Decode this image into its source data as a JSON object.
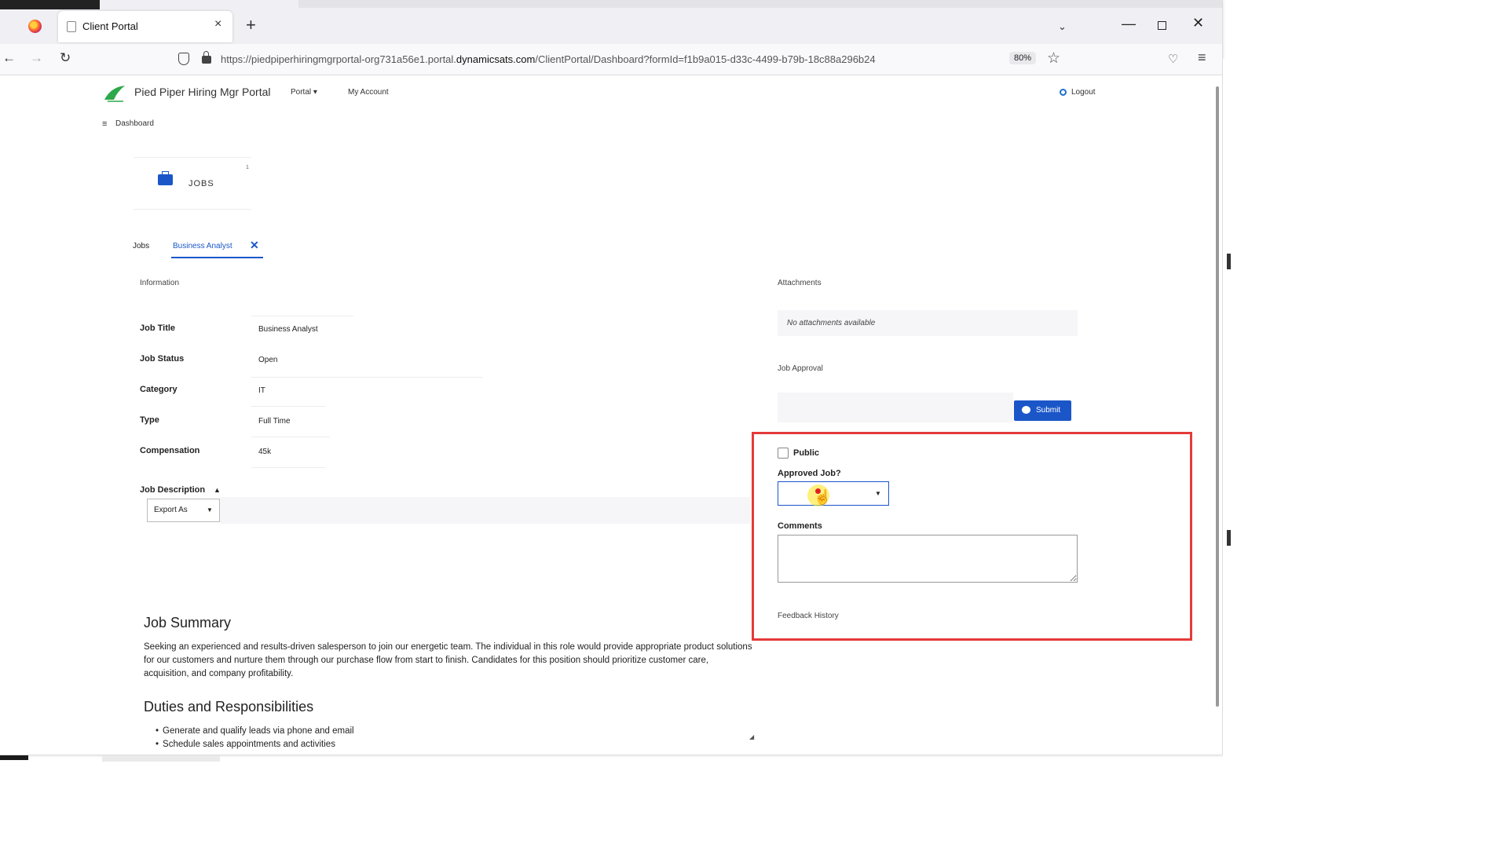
{
  "browser": {
    "tab_title": "Client Portal",
    "url_prefix": "https://piedpiperhiringmgrportal-org731a56e1.portal.",
    "url_host": "dynamicsats.com",
    "url_path": "/ClientPortal/Dashboard?formId=f1b9a015-d33c-4499-b79b-18c88a296b24",
    "zoom": "80%"
  },
  "header": {
    "brand": "Pied Piper Hiring Mgr Portal",
    "nav_portal": "Portal ▾",
    "nav_account": "My Account",
    "logout": "Logout",
    "dashboard": "Dashboard"
  },
  "jobs_card": {
    "label": "JOBS",
    "count": "1"
  },
  "tabs": [
    {
      "label": "Jobs"
    },
    {
      "label": "Business Analyst"
    }
  ],
  "information": {
    "heading": "Information",
    "fields": [
      {
        "label": "Job Title",
        "value": "Business Analyst"
      },
      {
        "label": "Job Status",
        "value": "Open"
      },
      {
        "label": "Category",
        "value": "IT"
      },
      {
        "label": "Type",
        "value": "Full Time"
      },
      {
        "label": "Compensation",
        "value": "45k"
      }
    ],
    "description_label": "Job Description",
    "export_label": "Export As"
  },
  "job_summary": {
    "title": "Job Summary",
    "text": "Seeking an experienced and results-driven salesperson to join our energetic team. The individual in this role would provide appropriate product solutions for our customers and nurture them through our purchase flow from start to finish. Candidates for this position should prioritize customer care, acquisition, and company profitability."
  },
  "duties": {
    "title": "Duties and Responsibilities",
    "items": [
      "Generate and qualify leads via phone and email",
      "Schedule sales appointments and activities"
    ]
  },
  "right_panel": {
    "attachments_heading": "Attachments",
    "attachments_empty": "No attachments available",
    "approval_heading": "Job Approval",
    "submit_label": "Submit",
    "public_label": "Public",
    "approved_label": "Approved Job?",
    "comments_label": "Comments",
    "feedback_heading": "Feedback History"
  },
  "colors": {
    "accent": "#1a56c8",
    "highlight": "#e53a3a"
  }
}
